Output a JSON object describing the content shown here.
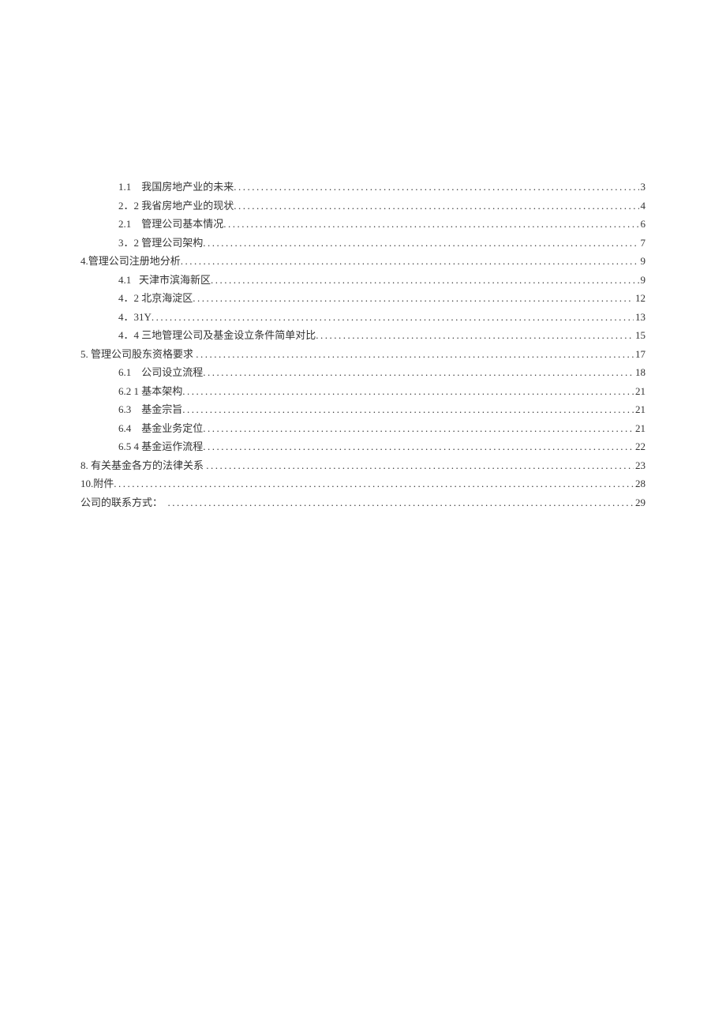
{
  "toc": {
    "entries": [
      {
        "indent": true,
        "num": "1.1",
        "title": "我国房地产业的未来",
        "page": "3"
      },
      {
        "indent": true,
        "num": "2．",
        "title": "2 我省房地产业的现状",
        "page": "4"
      },
      {
        "indent": true,
        "num": "2.1",
        "title": "管理公司基本情况",
        "page": "6"
      },
      {
        "indent": true,
        "num": "3．",
        "title": "2 管理公司架构",
        "page": "7"
      },
      {
        "indent": false,
        "num": "4.",
        "title": "管理公司注册地分析",
        "page": "9"
      },
      {
        "indent": true,
        "num": "4.1",
        "title": "天津市滨海新区",
        "page": "9"
      },
      {
        "indent": true,
        "num": "4．",
        "title": "2 北京海淀区",
        "page": "12"
      },
      {
        "indent": true,
        "num": "4．",
        "title": "31Y",
        "page": "13"
      },
      {
        "indent": true,
        "num": "4．",
        "title": "4 三地管理公司及基金设立条件简单对比",
        "page": "15"
      },
      {
        "indent": false,
        "num": "5.",
        "title": " 管理公司股东资格要求 ",
        "page": "17"
      },
      {
        "indent": true,
        "num": "6.1",
        "title": "公司设立流程",
        "page": "18"
      },
      {
        "indent": true,
        "num": "6.2",
        "title": " 1 基本架构",
        "page": "21"
      },
      {
        "indent": true,
        "num": "6.3",
        "title": "基金宗旨",
        "page": "21"
      },
      {
        "indent": true,
        "num": "6.4",
        "title": "基金业务定位",
        "page": "21"
      },
      {
        "indent": true,
        "num": "6.5",
        "title": " 4 基金运作流程",
        "page": "22"
      },
      {
        "indent": false,
        "num": "8.",
        "title": " 有关基金各方的法律关系 ",
        "page": "23"
      },
      {
        "indent": false,
        "num": "10.",
        "title": "附件",
        "page": "28"
      },
      {
        "indent": false,
        "num": "",
        "title": "公司的联系方式：  ",
        "page": "29"
      }
    ]
  }
}
